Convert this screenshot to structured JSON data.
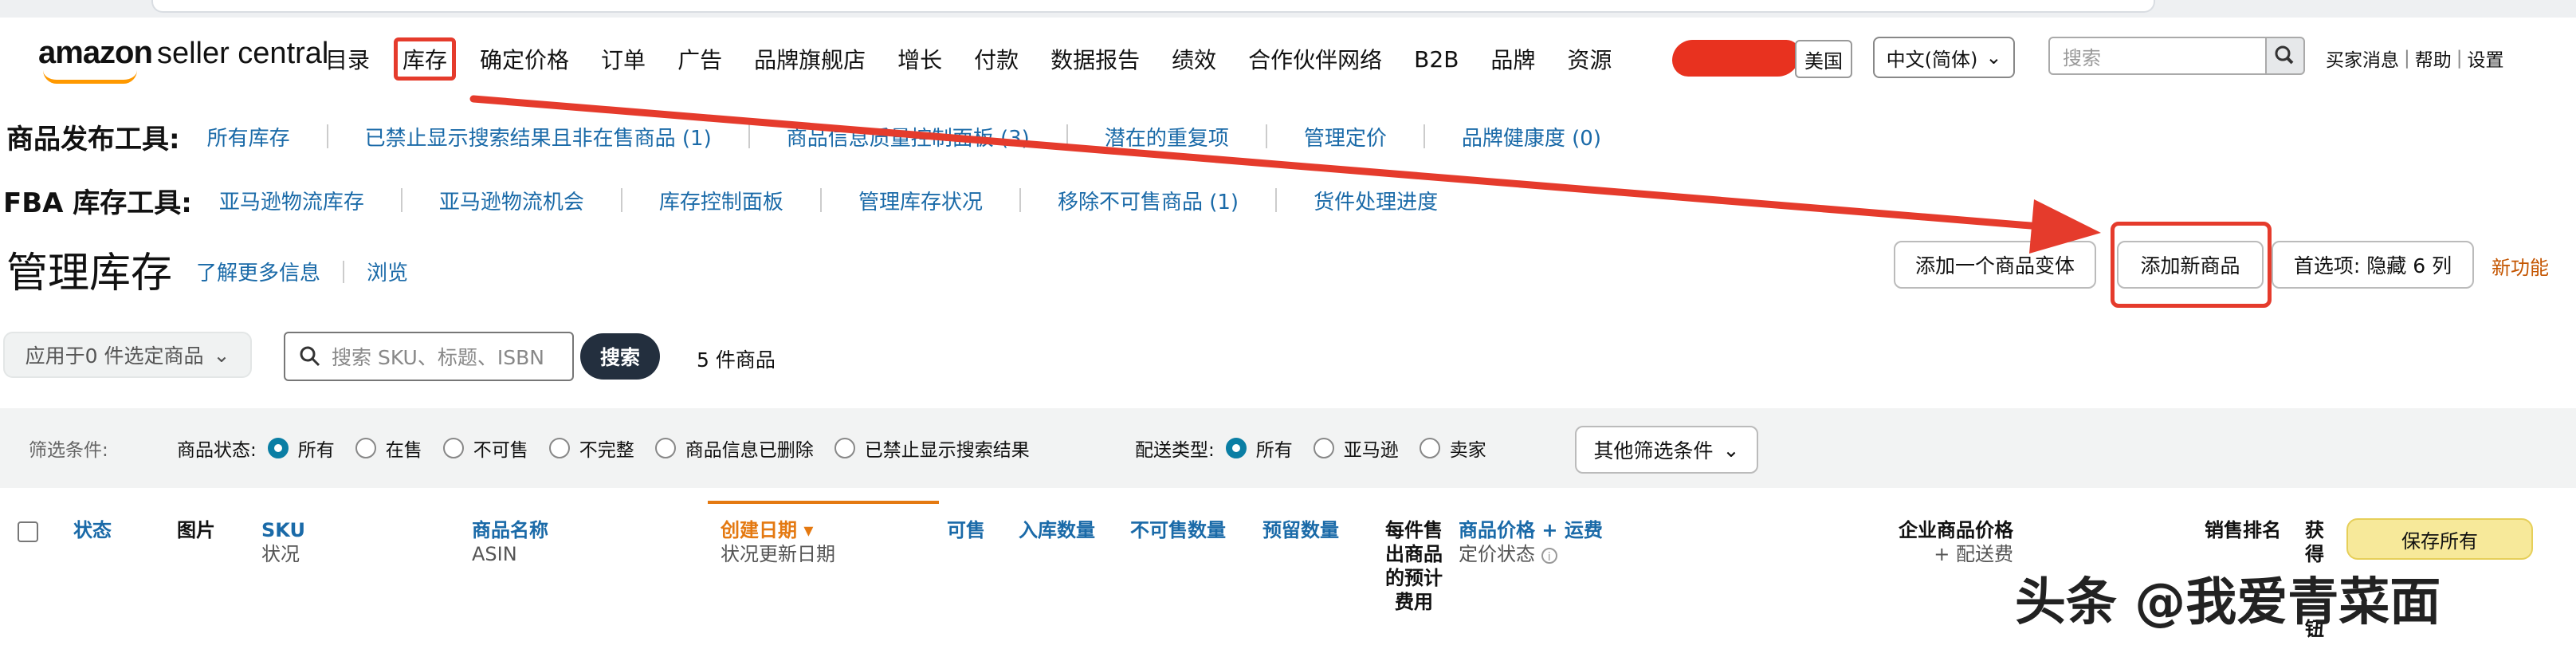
{
  "nav": {
    "logo_bold": "amazon",
    "logo_suffix": "seller central",
    "items": [
      "目录",
      "库存",
      "确定价格",
      "订单",
      "广告",
      "品牌旗舰店",
      "增长",
      "付款",
      "数据报告",
      "绩效",
      "合作伙伴网络",
      "B2B",
      "品牌",
      "资源"
    ],
    "marketplace": "美国",
    "language": "中文(简体)",
    "search_placeholder": "搜索",
    "links": [
      "买家消息",
      "帮助",
      "设置"
    ]
  },
  "product_tools": {
    "label": "商品发布工具:",
    "links": [
      "所有库存",
      "已禁止显示搜索结果且非在售商品 (1)",
      "商品信息质量控制面板 (3)",
      "潜在的重复项",
      "管理定价",
      "品牌健康度 (0)"
    ]
  },
  "fba_tools": {
    "label": "FBA 库存工具:",
    "links": [
      "亚马逊物流库存",
      "亚马逊物流机会",
      "库存控制面板",
      "管理库存状况",
      "移除不可售商品 (1)",
      "货件处理进度"
    ]
  },
  "page": {
    "title": "管理库存",
    "learn_more": "了解更多信息",
    "browse": "浏览",
    "add_variation": "添加一个商品变体",
    "add_product": "添加新商品",
    "preferences": "首选项: 隐藏 6 列",
    "new_feature": "新功能"
  },
  "search_row": {
    "apply_to": "应用于0 件选定商品",
    "placeholder": "搜索 SKU、标题、ISBN",
    "search_btn": "搜索",
    "count": "5 件商品"
  },
  "filters": {
    "label": "筛选条件:",
    "status_label": "商品状态:",
    "status_options": [
      "所有",
      "在售",
      "不可售",
      "不完整",
      "商品信息已删除",
      "已禁止显示搜索结果"
    ],
    "fulfillment_label": "配送类型:",
    "fulfillment_options": [
      "所有",
      "亚马逊",
      "卖家"
    ],
    "more": "其他筛选条件"
  },
  "table": {
    "status": "状态",
    "image": "图片",
    "sku": "SKU",
    "sku_sub": "状况",
    "name": "商品名称",
    "name_sub": "ASIN",
    "created": "创建日期 ▾",
    "created_sub": "状况更新日期",
    "available": "可售",
    "inbound": "入库数量",
    "unfulfillable": "不可售数量",
    "reserved": "预留数量",
    "fee_l1": "每件售",
    "fee_l2": "出商品",
    "fee_l3": "的预计",
    "fee_l4": "费用",
    "price": "商品价格 + 运费",
    "price_sub": "定价状态",
    "business_price": "企业商品价格",
    "business_sub": "+ 配送费",
    "rank": "销售排名",
    "buybox_l1": "获",
    "buybox_l2": "得",
    "buybox_l3": "钮",
    "save_all": "保存所有"
  },
  "watermark": "头条 @我爱青菜面",
  "colors": {
    "annotation_red": "#e53b2c",
    "link_blue": "#1a6aa8",
    "selected_radio": "#0a7ea4",
    "save_yellow": "#f7e99a"
  }
}
